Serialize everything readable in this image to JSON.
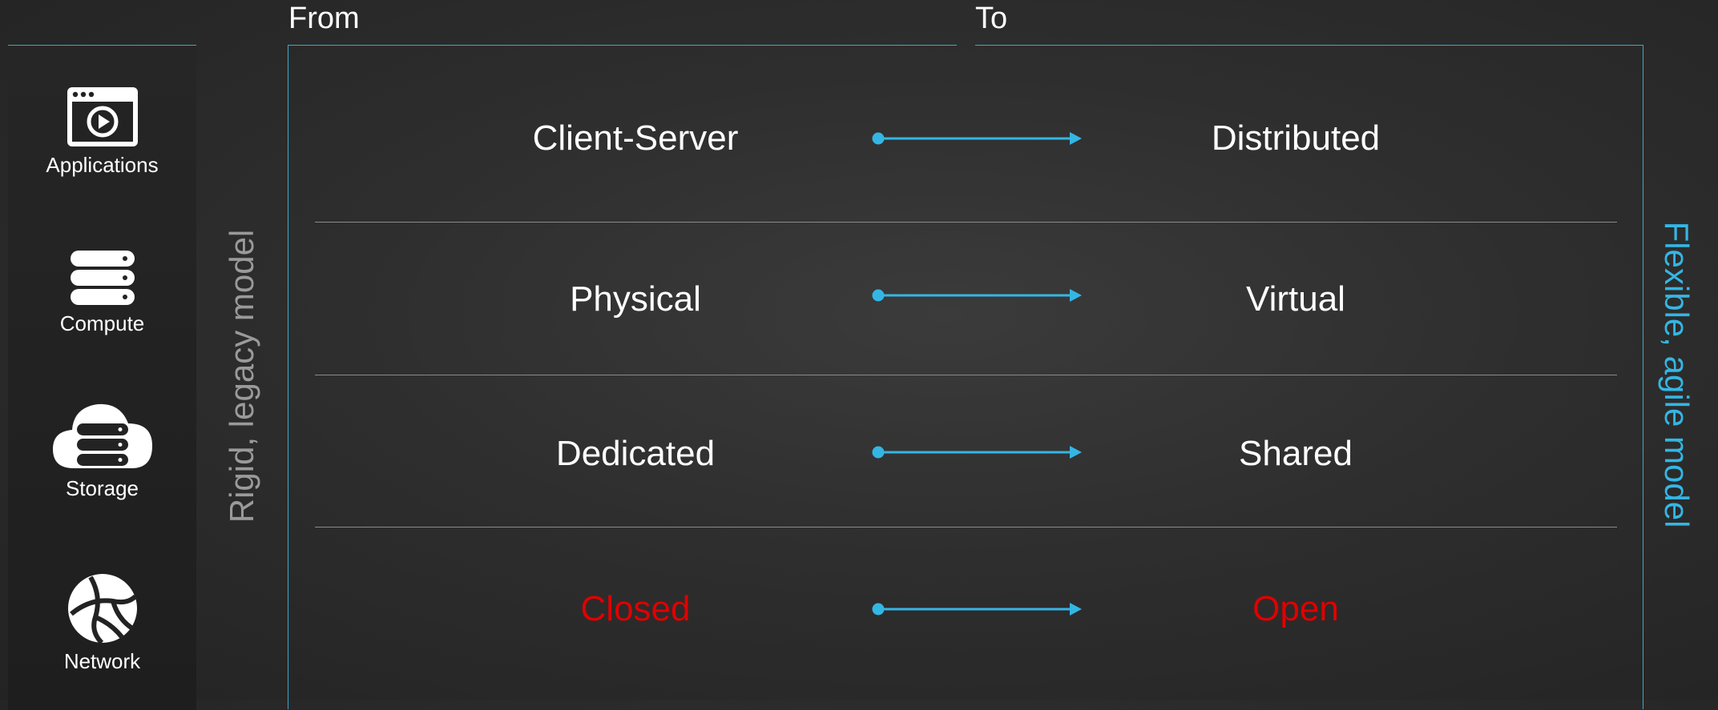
{
  "headers": {
    "from": "From",
    "to": "To"
  },
  "side_labels": {
    "left": "Rigid, legacy model",
    "right": "Flexible, agile model"
  },
  "categories": [
    {
      "label": "Applications",
      "icon": "application-window-icon"
    },
    {
      "label": "Compute",
      "icon": "server-stack-icon"
    },
    {
      "label": "Storage",
      "icon": "cloud-storage-icon"
    },
    {
      "label": "Network",
      "icon": "globe-network-icon"
    }
  ],
  "transitions": [
    {
      "from": "Client-Server",
      "to": "Distributed"
    },
    {
      "from": "Physical",
      "to": "Virtual"
    },
    {
      "from": "Dedicated",
      "to": "Shared"
    },
    {
      "from": "Closed",
      "to": "Open"
    }
  ],
  "colors": {
    "accent": "#34b6e4",
    "highlight_text": "#e00000",
    "normal_text": "#ffffff",
    "left_label": "#9a9a9a"
  }
}
